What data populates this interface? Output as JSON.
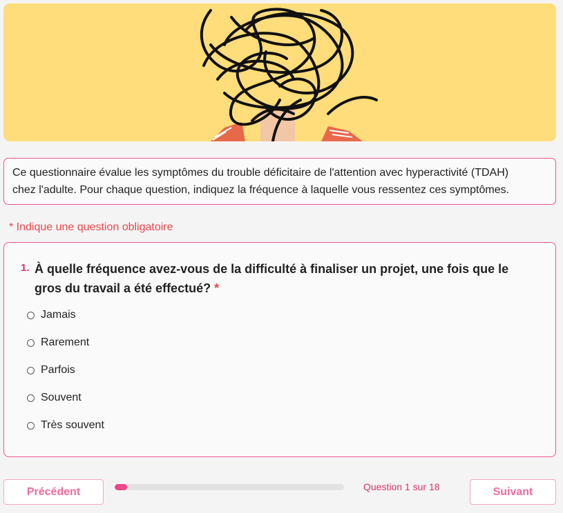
{
  "intro": {
    "line1": "Ce questionnaire évalue les symptômes du trouble déficitaire de l'attention avec hyperactivité (TDAH)",
    "line2": "chez l'adulte. Pour chaque question, indiquez la fréquence à laquelle vous ressentez ces symptômes."
  },
  "required_note": "* Indique une question obligatoire",
  "question": {
    "number": "1.",
    "text_line1": "À quelle fréquence avez-vous de la difficulté à finaliser un projet, une fois que le",
    "text_line2": "gros du travail a été effectué?",
    "required_marker": "*",
    "options": [
      "Jamais",
      "Rarement",
      "Parfois",
      "Souvent",
      "Très souvent"
    ]
  },
  "navigation": {
    "prev_label": "Précédent",
    "next_label": "Suivant",
    "progress_text": "Question 1 sur 18",
    "progress_fraction": 0.0556
  },
  "colors": {
    "banner_bg": "#ffdd7a",
    "accent": "#e9558f",
    "progress_fill": "#f0468a"
  },
  "icons": {
    "radio": "radio-unchecked-icon"
  }
}
